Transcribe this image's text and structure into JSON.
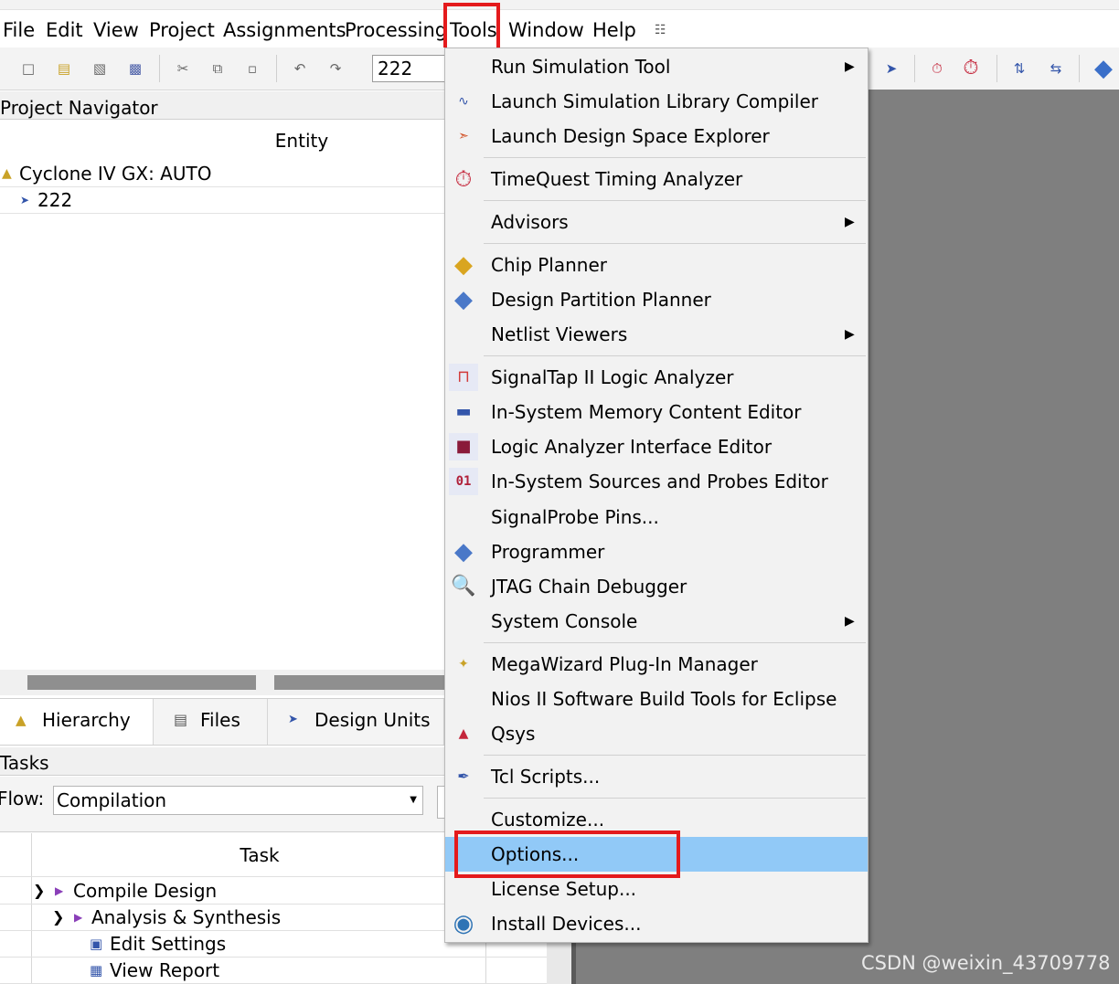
{
  "menubar": {
    "items": [
      "File",
      "Edit",
      "View",
      "Project",
      "Assignments",
      "Processing",
      "Tools",
      "Window",
      "Help"
    ]
  },
  "toolbar": {
    "entity_value": "222",
    "left_icons": [
      "new-file-icon",
      "open-icon",
      "save-icon",
      "save-all-icon",
      "cut-icon",
      "copy-icon",
      "paste-icon",
      "undo-icon",
      "redo-icon"
    ],
    "right_icons": [
      "netlist-icon",
      "timing-icon",
      "timequest-icon",
      "chip-planner-icon",
      "partition-icon",
      "programmer-icon"
    ]
  },
  "navigator": {
    "title": "Project Navigator",
    "column": "Entity",
    "device": "Cyclone IV GX: AUTO",
    "top_entity": "222"
  },
  "tabs": [
    "Hierarchy",
    "Files",
    "Design Units"
  ],
  "tasks": {
    "title": "Tasks",
    "flow_label": "Flow:",
    "flow_value": "Compilation",
    "column": "Task",
    "rows": [
      "Compile Design",
      "Analysis & Synthesis",
      "Edit Settings",
      "View Report"
    ]
  },
  "tools_menu": {
    "items": [
      {
        "label": "Run Simulation Tool",
        "icon": "",
        "submenu": true
      },
      {
        "label": "Launch Simulation Library Compiler",
        "icon": "sim-compiler-icon"
      },
      {
        "label": "Launch Design Space Explorer",
        "icon": "dse-icon"
      },
      {
        "label": "TimeQuest Timing Analyzer",
        "icon": "stopwatch-icon"
      },
      {
        "label": "Advisors",
        "icon": "",
        "submenu": true
      },
      {
        "label": "Chip Planner",
        "icon": "chip-planner-icon"
      },
      {
        "label": "Design Partition Planner",
        "icon": "partition-planner-icon"
      },
      {
        "label": "Netlist Viewers",
        "icon": "",
        "submenu": true
      },
      {
        "label": "SignalTap II Logic Analyzer",
        "icon": "signaltap-icon"
      },
      {
        "label": "In-System Memory Content Editor",
        "icon": "memory-editor-icon"
      },
      {
        "label": "Logic Analyzer Interface Editor",
        "icon": "lai-editor-icon"
      },
      {
        "label": "In-System Sources and Probes Editor",
        "icon": "sources-probes-icon"
      },
      {
        "label": "SignalProbe Pins...",
        "icon": ""
      },
      {
        "label": "Programmer",
        "icon": "programmer-icon"
      },
      {
        "label": "JTAG Chain Debugger",
        "icon": "jtag-debugger-icon"
      },
      {
        "label": "System Console",
        "icon": "",
        "submenu": true
      },
      {
        "label": "MegaWizard Plug-In Manager",
        "icon": "wand-icon"
      },
      {
        "label": "Nios II Software Build Tools for Eclipse",
        "icon": ""
      },
      {
        "label": "Qsys",
        "icon": "qsys-icon"
      },
      {
        "label": "Tcl Scripts...",
        "icon": "feather-icon"
      },
      {
        "label": "Customize...",
        "icon": ""
      },
      {
        "label": "Options...",
        "icon": "",
        "highlighted": true
      },
      {
        "label": "License Setup...",
        "icon": ""
      },
      {
        "label": "Install Devices...",
        "icon": "globe-icon"
      }
    ]
  },
  "watermark": "CSDN @weixin_43709778",
  "colors": {
    "highlight": "#91c9f7",
    "annotation": "#e41a1c",
    "workspace": "#7f7f7f"
  }
}
